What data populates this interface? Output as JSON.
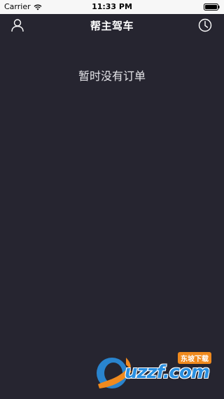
{
  "status_bar": {
    "carrier": "Carrier",
    "time": "11:33 PM"
  },
  "nav": {
    "title": "帮主驾车",
    "left_icon": "user-icon",
    "right_icon": "clock-icon"
  },
  "main": {
    "empty_message": "暂时没有订单"
  },
  "watermark": {
    "brand_text": "uzzf.com",
    "tag_text": "东坡下载"
  },
  "colors": {
    "background": "#262530",
    "status_bar": "#f7f7f7",
    "text_primary": "#ffffff",
    "watermark_blue": "#2a8fe0",
    "watermark_orange": "#f08a1e"
  }
}
